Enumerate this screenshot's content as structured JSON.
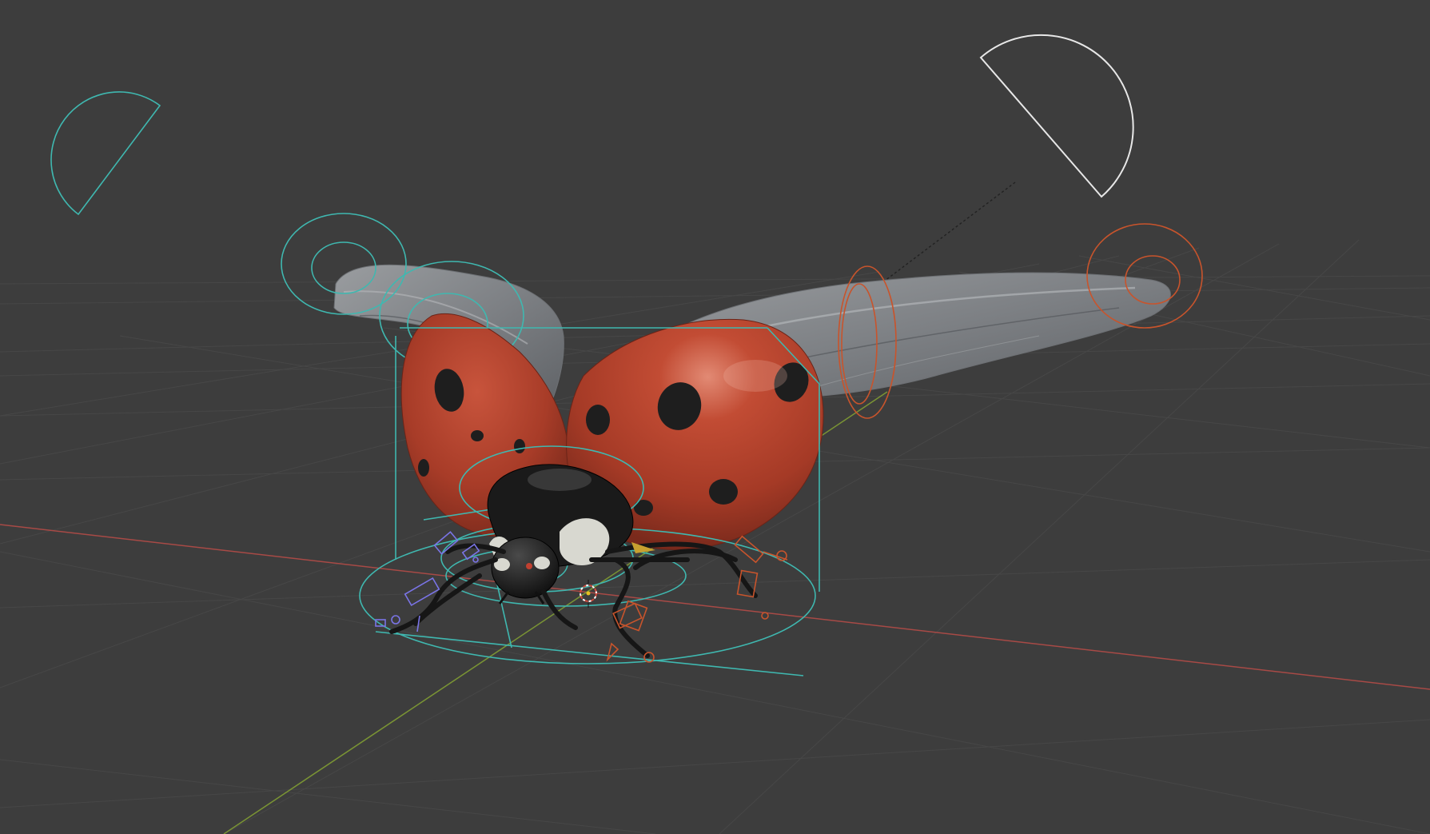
{
  "viewport": {
    "background": "#3d3d3d",
    "grid_color": "#4a4a4a",
    "x_axis_color": "#b85450",
    "y_axis_color": "#7f9b36",
    "rig_color": "#3fb8b0",
    "ik_color": "#d5582e",
    "bone_color": "#7a74e6",
    "light_color": "#e8e8e8",
    "ladybird": {
      "elytra_red": "#b0402a",
      "spot_color": "#1e1e1e",
      "wing_color": "#8a8d90",
      "pronotum_black": "#1a1a1a",
      "pronotum_white": "#d8d8d0"
    },
    "icons": [
      "area-light-icon",
      "sun-light-icon",
      "3d-cursor-icon",
      "armature-icon"
    ]
  }
}
